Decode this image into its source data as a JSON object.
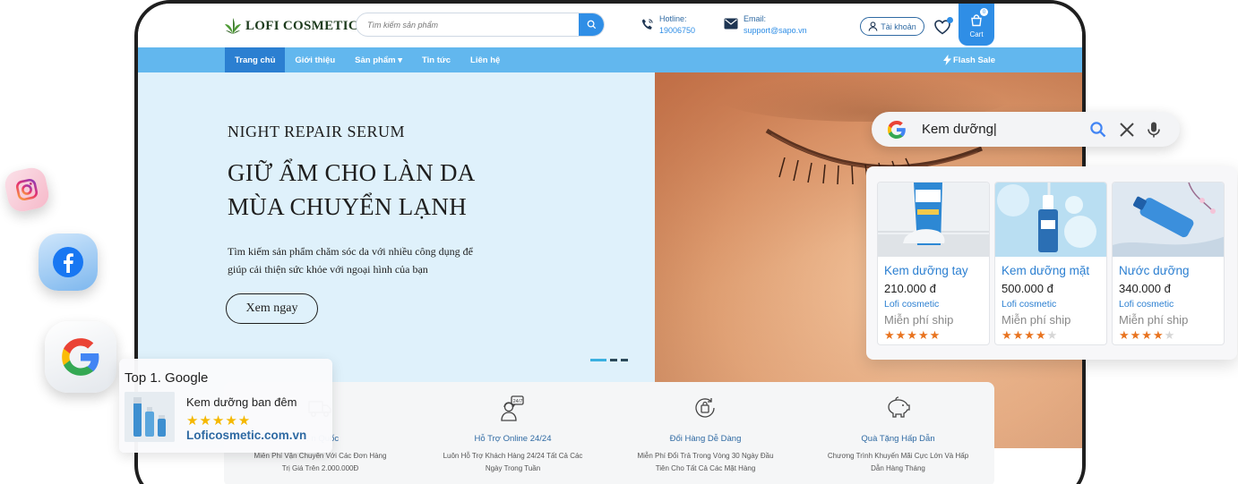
{
  "header": {
    "logo_text": "LOFI COSMETIC",
    "search_placeholder": "Tìm kiếm sản phẩm",
    "hotline_label": "Hotline:",
    "hotline_value": "19006750",
    "email_label": "Email:",
    "email_value": "support@sapo.vn",
    "account_label": "Tài khoản",
    "wishlist_count": "0",
    "cart_label": "Cart",
    "cart_count": "0"
  },
  "nav": {
    "items": [
      {
        "label": "Trang chủ",
        "active": true
      },
      {
        "label": "Giới thiệu"
      },
      {
        "label": "Sản phẩm ▾"
      },
      {
        "label": "Tin tức"
      },
      {
        "label": "Liên hệ"
      }
    ],
    "flash_sale": "Flash Sale"
  },
  "hero": {
    "subtitle": "NIGHT REPAIR SERUM",
    "title_line1": "GIỮ ẨM CHO LÀN DA",
    "title_line2": "MÙA CHUYỂN LẠNH",
    "desc_line1": "Tìm kiếm sản phẩm chăm sóc da với nhiều công dụng để",
    "desc_line2": "giúp cải thiện sức khỏe với ngoại hình của bạn",
    "button": "Xem ngay",
    "slides": 3,
    "active_slide": 1
  },
  "features": [
    {
      "icon": "shipping-icon",
      "title": "... n Quốc",
      "desc_line1": "Miễn Phí Vận Chuyển Với Các Đơn Hàng",
      "desc_line2": "Trị Giá Trên 2.000.000Đ"
    },
    {
      "icon": "support-icon",
      "title": "Hỗ Trợ Online 24/24",
      "desc_line1": "Luôn Hỗ Trợ Khách Hàng 24/24 Tất Cả Các",
      "desc_line2": "Ngày Trong Tuần"
    },
    {
      "icon": "return-icon",
      "title": "Đổi Hàng Dễ Dàng",
      "desc_line1": "Miễn Phí Đổi Trả Trong Vòng 30 Ngày Đầu",
      "desc_line2": "Tiên Cho Tất Cả Các Mặt Hàng"
    },
    {
      "icon": "gift-icon",
      "title": "Quà Tặng Hấp Dẫn",
      "desc_line1": "Chương Trình Khuyến Mãi Cực Lớn Và Hấp",
      "desc_line2": "Dẫn Hàng Tháng"
    }
  ],
  "top1": {
    "heading": "Top 1. Google",
    "product": "Kem dưỡng ban đêm",
    "stars": "★★★★★",
    "url": "Loficosmetic.com.vn"
  },
  "google_search": {
    "query": "Kem dưỡng|"
  },
  "products": [
    {
      "name": "Kem dưỡng tay",
      "price": "210.000 đ",
      "shop": "Lofi cosmetic",
      "shipping": "Miễn phí ship",
      "rating": 5
    },
    {
      "name": "Kem dưỡng mặt",
      "price": "500.000 đ",
      "shop": "Lofi cosmetic",
      "shipping": "Miễn phí ship",
      "rating": 4
    },
    {
      "name": "Nước dưỡng",
      "price": "340.000 đ",
      "shop": "Lofi cosmetic",
      "shipping": "Miễn phí ship",
      "rating": 4
    }
  ],
  "colors": {
    "primary": "#2f8ee6",
    "nav": "#62b7ee",
    "nav_active": "#2b7fd1",
    "hero_bg": "#dff1fb",
    "star": "#e8731f",
    "star_gold": "#f5b800"
  }
}
